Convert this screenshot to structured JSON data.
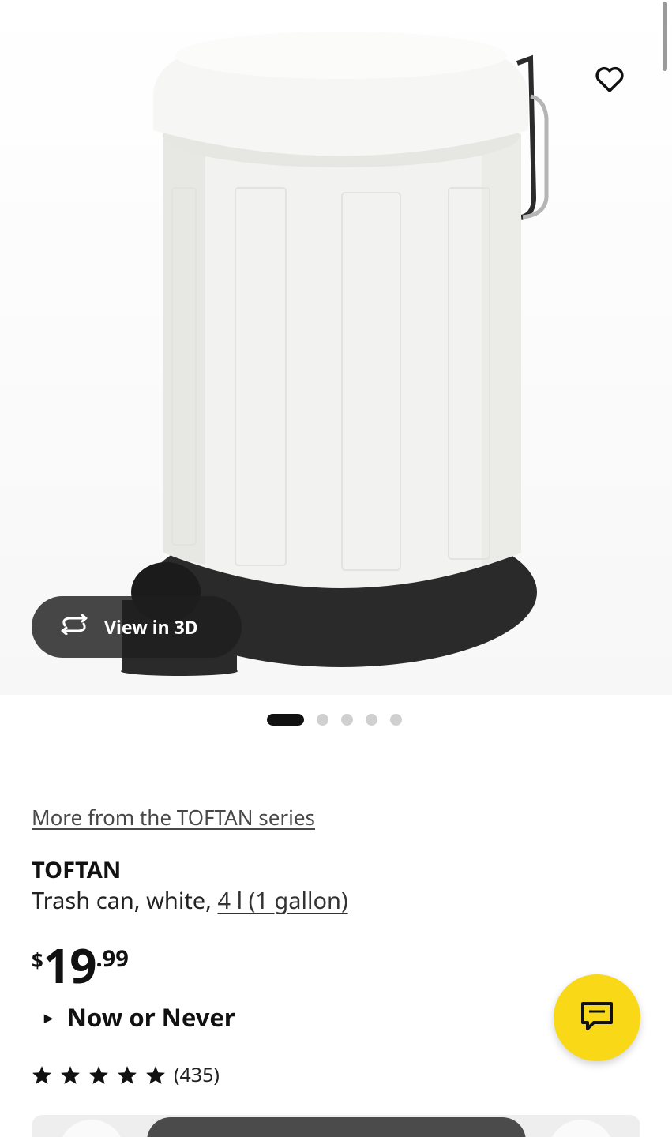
{
  "gallery": {
    "image_subject": "trash-can",
    "view3d_label": "View in 3D",
    "slide_count": 5,
    "active_slide": 1
  },
  "product": {
    "series_link": "More from the TOFTAN series",
    "name": "TOFTAN",
    "description_prefix": "Trash can, white, ",
    "size_link": "4 l (1 gallon)",
    "price_currency": "$",
    "price_integer": "19",
    "price_decimal": ".99",
    "family_label": "Now or Never",
    "rating": 5,
    "review_count": "(435)"
  },
  "icons": {
    "favorite": "heart-icon",
    "view3d": "rotate-icon",
    "chat": "chat-bubble-icon",
    "rating": "star-icon",
    "expand": "triangle-right-icon"
  },
  "colors": {
    "accent_yellow": "#F8D817",
    "text": "#111111",
    "link": "#484848"
  }
}
